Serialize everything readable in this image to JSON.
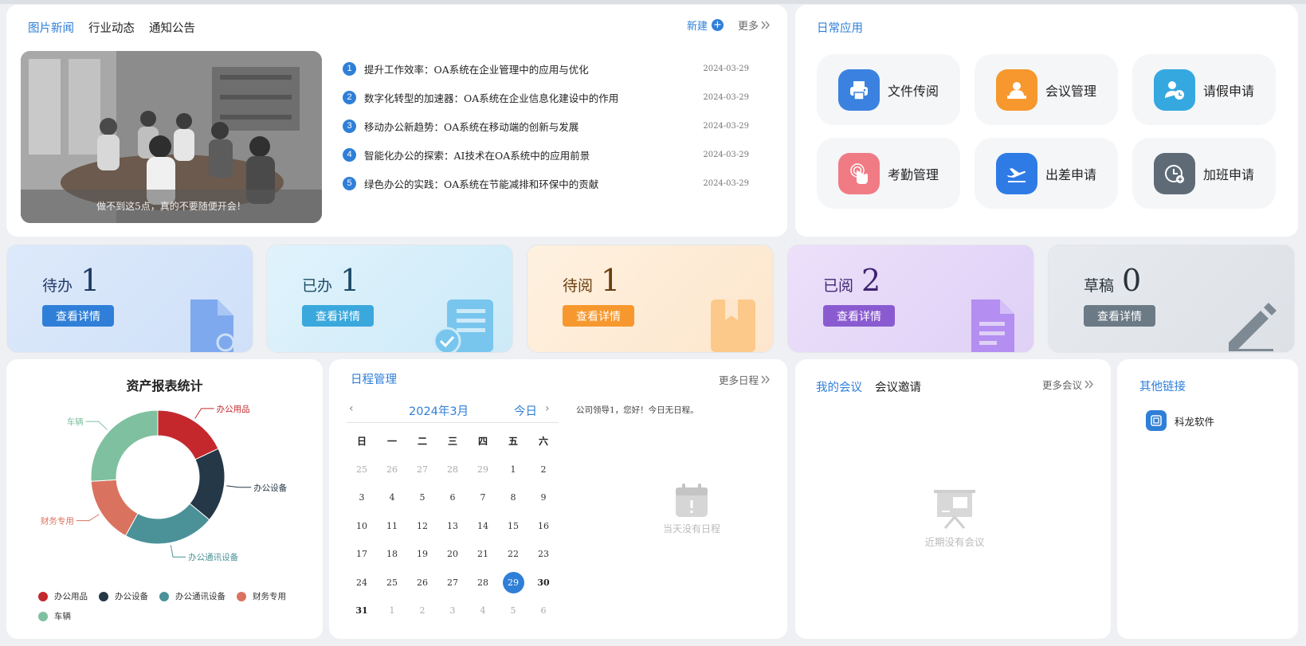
{
  "news": {
    "tabs": [
      "图片新闻",
      "行业动态",
      "通知公告"
    ],
    "new_label": "新建",
    "new_icon": "+",
    "more_label": "更多",
    "caption": "做不到这5点，真的不要随便开会！",
    "items": [
      {
        "num": "1",
        "title": "提升工作效率：OA系统在企业管理中的应用与优化",
        "date": "2024-03-29"
      },
      {
        "num": "2",
        "title": "数字化转型的加速器：OA系统在企业信息化建设中的作用",
        "date": "2024-03-29"
      },
      {
        "num": "3",
        "title": "移动办公新趋势：OA系统在移动端的创新与发展",
        "date": "2024-03-29"
      },
      {
        "num": "4",
        "title": "智能化办公的探索：AI技术在OA系统中的应用前景",
        "date": "2024-03-29"
      },
      {
        "num": "5",
        "title": "绿色办公的实践：OA系统在节能减排和环保中的贡献",
        "date": "2024-03-29"
      }
    ]
  },
  "apps": {
    "title": "日常应用",
    "items": [
      {
        "label": "文件传阅",
        "color": "#3b82e0",
        "icon": "printer-icon"
      },
      {
        "label": "会议管理",
        "color": "#f6982e",
        "icon": "meeting-icon"
      },
      {
        "label": "请假申请",
        "color": "#35a8e0",
        "icon": "leave-icon"
      },
      {
        "label": "考勤管理",
        "color": "#f07b85",
        "icon": "fingerprint-icon"
      },
      {
        "label": "出差申请",
        "color": "#2f7be6",
        "icon": "airplane-icon"
      },
      {
        "label": "加班申请",
        "color": "#5e6b77",
        "icon": "clock-icon"
      }
    ]
  },
  "stats": [
    {
      "label": "待办",
      "count": "1",
      "button": "查看详情",
      "bg": "#dbe8fb",
      "btn": "#2f7fd8",
      "fg": "#1f3a66"
    },
    {
      "label": "已办",
      "count": "1",
      "button": "查看详情",
      "bg": "#d6effb",
      "btn": "#3aa8dc",
      "fg": "#1d4a66"
    },
    {
      "label": "待阅",
      "count": "1",
      "button": "查看详情",
      "bg": "#fdebd6",
      "btn": "#f6982e",
      "fg": "#6a3e10"
    },
    {
      "label": "已阅",
      "count": "2",
      "button": "查看详情",
      "bg": "#e7dbf8",
      "btn": "#8a5bd0",
      "fg": "#3f2470"
    },
    {
      "label": "草稿",
      "count": "0",
      "button": "查看详情",
      "bg": "#e3e6ea",
      "btn": "#6c7a86",
      "fg": "#2a333b"
    }
  ],
  "asset": {
    "title": "资产报表统计"
  },
  "chart_data": {
    "type": "pie",
    "title": "资产报表统计",
    "donut": true,
    "legend_position": "bottom",
    "categories": [
      "办公用品",
      "办公设备",
      "办公通讯设备",
      "财务专用",
      "车辆"
    ],
    "values": [
      18,
      18,
      22,
      16,
      26
    ],
    "colors": [
      "#c4282d",
      "#253848",
      "#4a9298",
      "#d9735f",
      "#7ec09f"
    ]
  },
  "schedule": {
    "title": "日程管理",
    "more_label": "更多日程",
    "month_label": "2024年3月",
    "today_label": "今日",
    "weekdays": [
      "日",
      "一",
      "二",
      "三",
      "四",
      "五",
      "六"
    ],
    "weeks": [
      [
        {
          "d": "25",
          "m": true
        },
        {
          "d": "26",
          "m": true
        },
        {
          "d": "27",
          "m": true
        },
        {
          "d": "28",
          "m": true
        },
        {
          "d": "29",
          "m": true
        },
        {
          "d": "1"
        },
        {
          "d": "2"
        }
      ],
      [
        {
          "d": "3"
        },
        {
          "d": "4"
        },
        {
          "d": "5"
        },
        {
          "d": "6"
        },
        {
          "d": "7"
        },
        {
          "d": "8"
        },
        {
          "d": "9"
        }
      ],
      [
        {
          "d": "10"
        },
        {
          "d": "11"
        },
        {
          "d": "12"
        },
        {
          "d": "13"
        },
        {
          "d": "14"
        },
        {
          "d": "15"
        },
        {
          "d": "16"
        }
      ],
      [
        {
          "d": "17"
        },
        {
          "d": "18"
        },
        {
          "d": "19"
        },
        {
          "d": "20"
        },
        {
          "d": "21"
        },
        {
          "d": "22"
        },
        {
          "d": "23"
        }
      ],
      [
        {
          "d": "24"
        },
        {
          "d": "25"
        },
        {
          "d": "26"
        },
        {
          "d": "27"
        },
        {
          "d": "28"
        },
        {
          "d": "29",
          "sel": true
        },
        {
          "d": "30",
          "b": true
        }
      ],
      [
        {
          "d": "31",
          "b": true
        },
        {
          "d": "1",
          "m": true
        },
        {
          "d": "2",
          "m": true
        },
        {
          "d": "3",
          "m": true
        },
        {
          "d": "4",
          "m": true
        },
        {
          "d": "5",
          "m": true
        },
        {
          "d": "6",
          "m": true
        }
      ]
    ],
    "greeting": "公司领导1，您好！今日无日程。",
    "empty_text": "当天没有日程"
  },
  "meetings": {
    "tabs": [
      "我的会议",
      "会议邀请"
    ],
    "more_label": "更多会议",
    "empty_text": "近期没有会议"
  },
  "links": {
    "title": "其他链接",
    "items": [
      "科龙软件"
    ]
  }
}
